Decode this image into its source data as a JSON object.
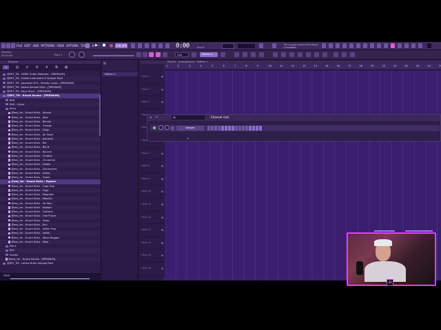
{
  "app": {
    "menu": [
      "FILE",
      "EDIT",
      "ADD",
      "PATTERNS",
      "VIEW",
      "OPTIONS",
      "TOOLS",
      "HELP"
    ],
    "bpm": "140.000",
    "time": "0:00",
    "time_unit": "M:S:CS",
    "cpu_label": "0",
    "hint": "Tip: A newer version of FL Studio is available!",
    "project_info": [
      "(Master)",
      "03:15:08"
    ],
    "track_label": "Track 1",
    "snap": "Line",
    "pattern": "Pattern 1"
  },
  "browser": {
    "title": "Browser",
    "tools": [
      "◂",
      "▤",
      "≡",
      "⊕",
      "★",
      "⧉",
      "▦"
    ],
    "items": [
      {
        "label": "@EEY_TM - GEMS Guitar Melodies - [PREMIUM]",
        "kind": "folder",
        "indent": 1
      },
      {
        "label": "@EEY_TM - Guitar Instrument & Sample Pack",
        "kind": "folder",
        "indent": 1
      },
      {
        "label": "@EEY_TM - Japanese Drill - Melody Loops - [PREMIUM]",
        "kind": "folder",
        "indent": 1
      },
      {
        "label": "@EEY_TM - Kawai Sample Pack - [PREMIUM]",
        "kind": "folder",
        "indent": 1
      },
      {
        "label": "@EEY_TM - Keys Music - [PREMIUM]",
        "kind": "folder",
        "indent": 1
      },
      {
        "label": "@EEY_TM - Knock Drums - [PREMIUM]",
        "kind": "folder",
        "indent": 1,
        "selected": true
      },
      {
        "label": "808",
        "kind": "folder",
        "indent": 2
      },
      {
        "label": "808 - Chord",
        "kind": "folder",
        "indent": 2
      },
      {
        "label": "Kicks",
        "kind": "folder",
        "indent": 2
      },
      {
        "label": "@eey_tm - Knock Kicks - Abnsie",
        "kind": "file",
        "indent": 3
      },
      {
        "label": "@eey_tm - Knock Kicks - Bajo",
        "kind": "file",
        "indent": 3
      },
      {
        "label": "@eey_tm - Knock Kicks - Bonnie",
        "kind": "file",
        "indent": 3
      },
      {
        "label": "@eey_tm - Knock Kicks - Garage",
        "kind": "file",
        "indent": 3
      },
      {
        "label": "@eey_tm - Knock Kicks - Dinja",
        "kind": "file",
        "indent": 3
      },
      {
        "label": "@eey_tm - Knock Kicks - Air Slash",
        "kind": "file",
        "indent": 3
      },
      {
        "label": "@eey_tm - Knock Kicks - Advance",
        "kind": "file",
        "indent": 3
      },
      {
        "label": "@eey_tm - Knock Kicks - Bal",
        "kind": "file",
        "indent": 3
      },
      {
        "label": "@eey_tm - Knock Kicks - Big B",
        "kind": "file",
        "indent": 3
      },
      {
        "label": "@eey_tm - Knock Kicks - Bounce",
        "kind": "file",
        "indent": 3
      },
      {
        "label": "@eey_tm - Knock Kicks - Chubby",
        "kind": "file",
        "indent": 3
      },
      {
        "label": "@eey_tm - Knock Kicks - Circuemia",
        "kind": "file",
        "indent": 3
      },
      {
        "label": "@eey_tm - Knock Kicks - Diablo",
        "kind": "file",
        "indent": 3
      },
      {
        "label": "@eey_tm - Knock Kicks - Documents",
        "kind": "file",
        "indent": 3
      },
      {
        "label": "@eey_tm - Knock Kicks - Driller",
        "kind": "file",
        "indent": 3
      },
      {
        "label": "@eey_tm - Knock Kicks - Duber",
        "kind": "file",
        "indent": 3
      },
      {
        "label": "@eey_tm - Knock Kicks - Espace",
        "kind": "file",
        "indent": 3,
        "selected": true
      },
      {
        "label": "@eey_tm - Knock Kicks - Fuga Trap",
        "kind": "file",
        "indent": 3
      },
      {
        "label": "@eey_tm - Knock Kicks - Fuga",
        "kind": "file",
        "indent": 3
      },
      {
        "label": "@eey_tm - Knock Kicks - Magnetic",
        "kind": "file",
        "indent": 3
      },
      {
        "label": "@eey_tm - Knock Kicks - Metallic",
        "kind": "file",
        "indent": 3
      },
      {
        "label": "@eey_tm - Knock Kicks - No Way",
        "kind": "file",
        "indent": 3
      },
      {
        "label": "@eey_tm - Knock Kicks - Nubber",
        "kind": "file",
        "indent": 3
      },
      {
        "label": "@eey_tm - Knock Kicks - Oakland",
        "kind": "file",
        "indent": 3
      },
      {
        "label": "@eey_tm - Knock Kicks - One Punch",
        "kind": "file",
        "indent": 3
      },
      {
        "label": "@eey_tm - Knock Kicks - Pesta",
        "kind": "file",
        "indent": 3
      },
      {
        "label": "@eey_tm - Knock Kicks - Run",
        "kind": "file",
        "indent": 3
      },
      {
        "label": "@eey_tm - Knock Kicks - Softer Trap",
        "kind": "file",
        "indent": 3
      },
      {
        "label": "@eey_tm - Knock Kicks - Softer",
        "kind": "file",
        "indent": 3
      },
      {
        "label": "@eey_tm - Knock Kicks - Wave Boggan",
        "kind": "file",
        "indent": 3
      },
      {
        "label": "@eey_tm - Knock Kicks - Wise",
        "kind": "file",
        "indent": 3
      },
      {
        "label": "Percs",
        "kind": "folder",
        "indent": 2
      },
      {
        "label": "Rim",
        "kind": "folder",
        "indent": 2
      },
      {
        "label": "Snares",
        "kind": "folder",
        "indent": 2
      },
      {
        "label": "@eey_tm - Knock Drums - [PREMIUM]",
        "kind": "file",
        "indent": 2
      },
      {
        "label": "@EEY_TM - Latina Music Sample Pack",
        "kind": "folder",
        "indent": 1
      }
    ],
    "bottom_label": "TAGS"
  },
  "picker": {
    "menu": "▥",
    "item": "Pattern 1"
  },
  "playlist": {
    "title": "Playlist - Arrangement › Pattern 1",
    "ruler": [
      "1",
      "2",
      "3",
      "4",
      "5",
      "6",
      "7",
      "8",
      "9",
      "10",
      "11",
      "12",
      "13",
      "14",
      "15",
      "16",
      "17",
      "18",
      "19",
      "20",
      "21",
      "22",
      "23",
      "24",
      "25"
    ],
    "tracks": [
      "Track 1",
      "Track 2",
      "Track 3",
      "Track 4",
      "Track 5",
      "Track 6",
      "Track 7",
      "Track 8",
      "Track 9",
      "Track 10",
      "Track 11",
      "Track 12",
      "Track 13",
      "Track 14",
      "Track 15",
      "Track 16"
    ]
  },
  "rack": {
    "filter": "All",
    "title": "Channel rack",
    "channel": "Sampler",
    "add": "+"
  },
  "cam": {
    "badge": "33"
  },
  "colors": {
    "accent": "#e040ff",
    "panel": "#2a1a45",
    "grid": "#3a1f6e"
  }
}
